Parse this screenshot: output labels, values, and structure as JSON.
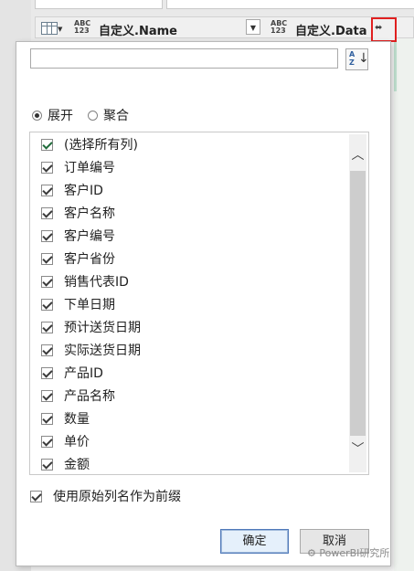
{
  "header": {
    "type_badge": [
      "ABC",
      "123"
    ],
    "col1_name": "自定义.Name",
    "col2_name": "自定义.Data",
    "dropdown_glyph": "▼",
    "expand_glyph": "⬌"
  },
  "popup": {
    "search": {
      "value": "",
      "placeholder": ""
    },
    "sort_icon_letters": [
      "A",
      "Z"
    ],
    "radio_expand": "展开",
    "radio_aggregate": "聚合",
    "radio_selected": "展开",
    "items": [
      {
        "label": "(选择所有列)",
        "checked": true
      },
      {
        "label": "订单编号",
        "checked": true
      },
      {
        "label": "客户ID",
        "checked": true
      },
      {
        "label": "客户名称",
        "checked": true
      },
      {
        "label": "客户编号",
        "checked": true
      },
      {
        "label": "客户省份",
        "checked": true
      },
      {
        "label": "销售代表ID",
        "checked": true
      },
      {
        "label": "下单日期",
        "checked": true
      },
      {
        "label": "预计送货日期",
        "checked": true
      },
      {
        "label": "实际送货日期",
        "checked": true
      },
      {
        "label": "产品ID",
        "checked": true
      },
      {
        "label": "产品名称",
        "checked": true
      },
      {
        "label": "数量",
        "checked": true
      },
      {
        "label": "单价",
        "checked": true
      },
      {
        "label": "金额",
        "checked": true
      }
    ],
    "use_prefix_label": "使用原始列名作为前缀",
    "use_prefix_checked": true,
    "ok_label": "确定",
    "cancel_label": "取消"
  },
  "watermark": "PowerBI研究所",
  "colors": {
    "highlight_border": "#e02020",
    "ok_border": "#4f79b9"
  }
}
